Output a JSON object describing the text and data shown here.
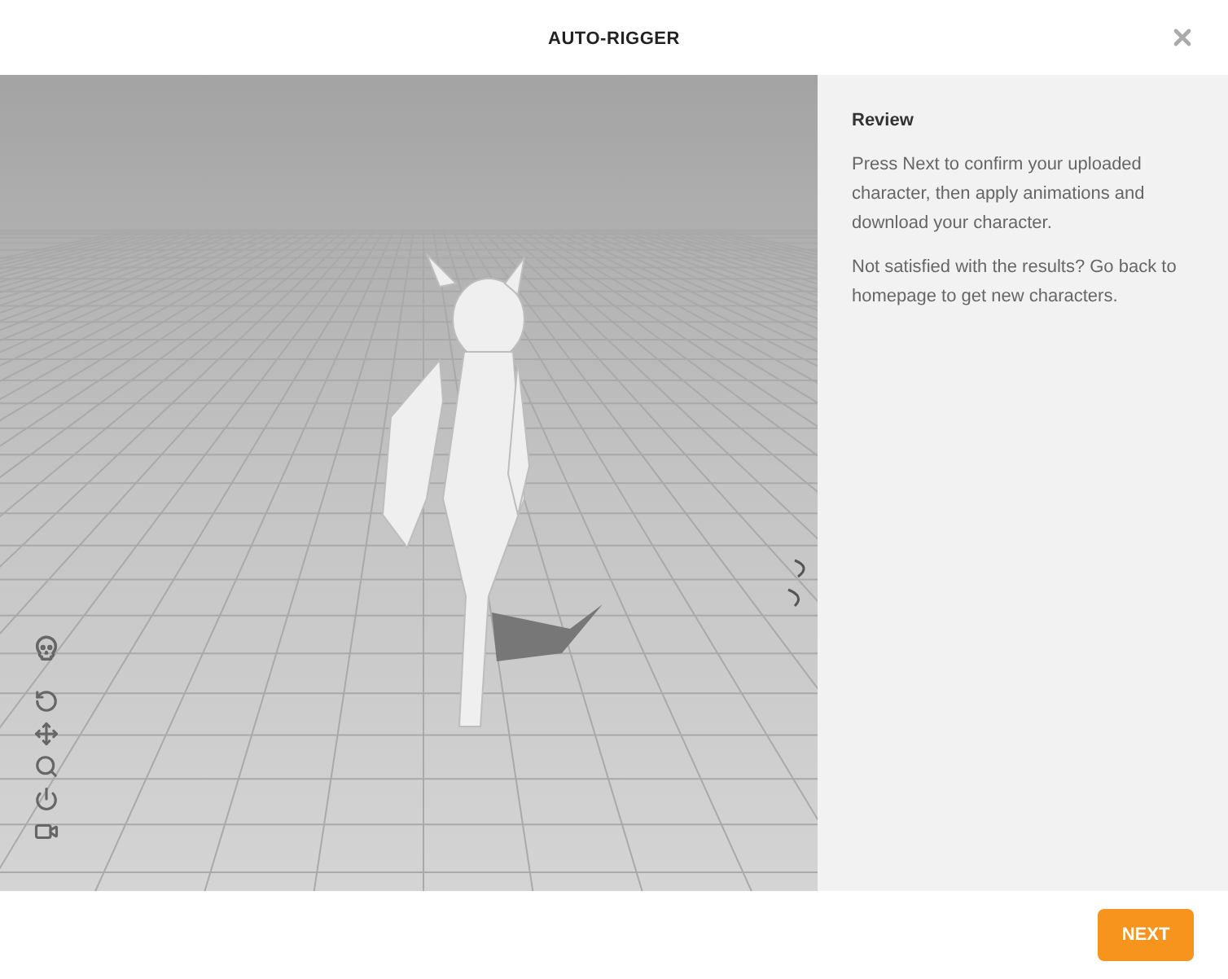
{
  "window": {
    "title": "AUTO-RIGGER"
  },
  "side_panel": {
    "heading": "Review",
    "paragraphs": [
      "Press Next to confirm your uploaded character, then apply animations and download your character.",
      "Not satisfied with the results? Go back to homepage to get new characters."
    ]
  },
  "viewport_tools": [
    {
      "kind": "skeleton"
    },
    {
      "kind": "reset"
    },
    {
      "kind": "pan"
    },
    {
      "kind": "zoom"
    },
    {
      "kind": "power"
    },
    {
      "kind": "camera"
    }
  ],
  "footer": {
    "next_button": "NEXT"
  }
}
